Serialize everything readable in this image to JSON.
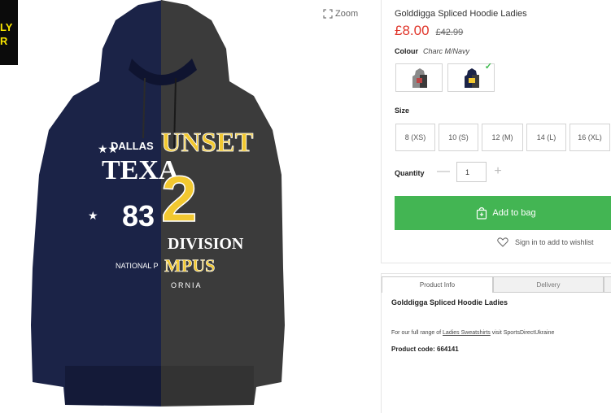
{
  "promo": {
    "line1": "LY",
    "line2": "R"
  },
  "zoom": {
    "label": "Zoom"
  },
  "product": {
    "title": "Golddigga Spliced Hoodie Ladies",
    "price": "£8.00",
    "was_price": "£42.99",
    "colour_label": "Colour",
    "colour_value": "Charc M/Navy",
    "hoodie_print": [
      "DALLAS",
      "TEXA",
      "83",
      "UNSET",
      "2",
      "DIVISION",
      "MPUS",
      "NATIONAL P",
      "ORNIA"
    ]
  },
  "size": {
    "label": "Size",
    "options": [
      "8 (XS)",
      "10 (S)",
      "12 (M)",
      "14 (L)",
      "16 (XL)"
    ]
  },
  "quantity": {
    "label": "Quantity",
    "value": "1",
    "minus": "—",
    "plus": "+"
  },
  "actions": {
    "add_to_bag": "Add to bag",
    "wishlist": "Sign in to add to wishlist"
  },
  "tabs": [
    "Product Info",
    "Delivery"
  ],
  "info": {
    "title": "Golddigga Spliced Hoodie Ladies",
    "range_prefix": "For our full range of ",
    "range_link": "Ladies Sweatshirts",
    "range_suffix": " visit SportsDirectUkraine",
    "code": "Product code: 664141"
  },
  "colors": {
    "price": "#e0362b",
    "add_to_bag": "#43b553",
    "navy": "#1b2347",
    "charcoal": "#3b3b3b",
    "print_gold": "#f2c830"
  }
}
